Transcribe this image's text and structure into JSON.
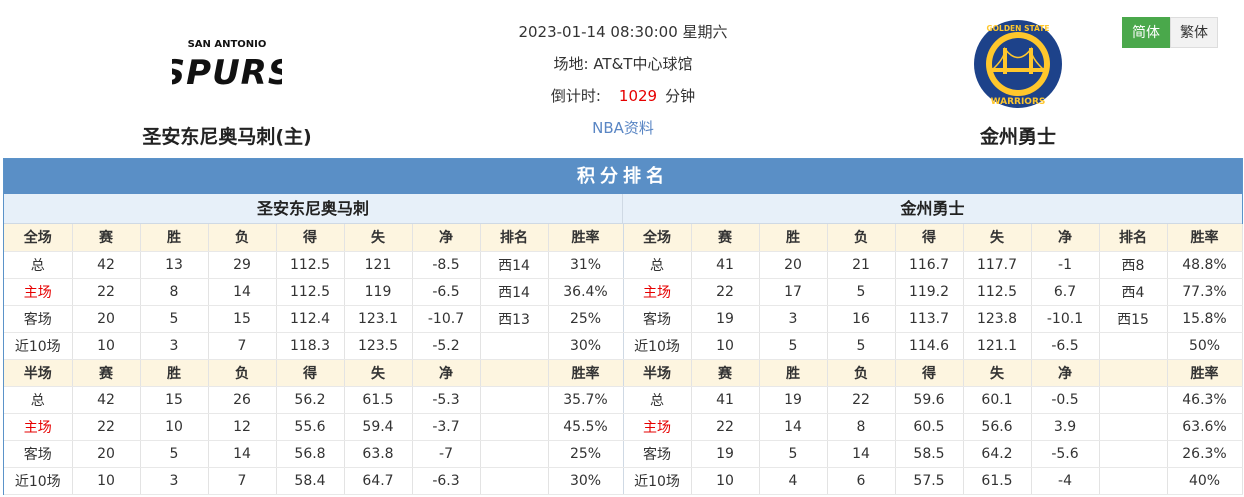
{
  "home_team": {
    "name": "圣安东尼奥马刺(主)",
    "logo": "spurs-logo",
    "logo_text_top": "SAN ANTONIO",
    "logo_text_main": "SPURS"
  },
  "away_team": {
    "name": "金州勇士",
    "logo": "warriors-logo",
    "logo_text_top": "GOLDEN STATE",
    "logo_text_bottom": "WARRIORS"
  },
  "match": {
    "datetime": "2023-01-14 08:30:00 星期六",
    "venue": "场地: AT&T中心球馆",
    "countdown_label": "倒计时:",
    "countdown_value": "1029",
    "countdown_unit": "分钟",
    "nba_link": "NBA资料"
  },
  "lang": {
    "simplified": "简体",
    "traditional": "繁体"
  },
  "standings": {
    "title": "积分排名",
    "home_title": "圣安东尼奥马刺",
    "away_title": "金州勇士",
    "full_header": [
      "全场",
      "赛",
      "胜",
      "负",
      "得",
      "失",
      "净",
      "排名",
      "胜率"
    ],
    "half_header": [
      "半场",
      "赛",
      "胜",
      "负",
      "得",
      "失",
      "净",
      "",
      "胜率"
    ],
    "full_rows": [
      {
        "home": [
          "总",
          "42",
          "13",
          "29",
          "112.5",
          "121",
          "-8.5",
          "西14",
          "31%"
        ],
        "away": [
          "总",
          "41",
          "20",
          "21",
          "116.7",
          "117.7",
          "-1",
          "西8",
          "48.8%"
        ]
      },
      {
        "home": [
          "主场",
          "22",
          "8",
          "14",
          "112.5",
          "119",
          "-6.5",
          "西14",
          "36.4%"
        ],
        "away": [
          "主场",
          "22",
          "17",
          "5",
          "119.2",
          "112.5",
          "6.7",
          "西4",
          "77.3%"
        ]
      },
      {
        "home": [
          "客场",
          "20",
          "5",
          "15",
          "112.4",
          "123.1",
          "-10.7",
          "西13",
          "25%"
        ],
        "away": [
          "客场",
          "19",
          "3",
          "16",
          "113.7",
          "123.8",
          "-10.1",
          "西15",
          "15.8%"
        ]
      },
      {
        "home": [
          "近10场",
          "10",
          "3",
          "7",
          "118.3",
          "123.5",
          "-5.2",
          "",
          "30%"
        ],
        "away": [
          "近10场",
          "10",
          "5",
          "5",
          "114.6",
          "121.1",
          "-6.5",
          "",
          "50%"
        ]
      }
    ],
    "half_rows": [
      {
        "home": [
          "总",
          "42",
          "15",
          "26",
          "56.2",
          "61.5",
          "-5.3",
          "",
          "35.7%"
        ],
        "away": [
          "总",
          "41",
          "19",
          "22",
          "59.6",
          "60.1",
          "-0.5",
          "",
          "46.3%"
        ]
      },
      {
        "home": [
          "主场",
          "22",
          "10",
          "12",
          "55.6",
          "59.4",
          "-3.7",
          "",
          "45.5%"
        ],
        "away": [
          "主场",
          "22",
          "14",
          "8",
          "60.5",
          "56.6",
          "3.9",
          "",
          "63.6%"
        ]
      },
      {
        "home": [
          "客场",
          "20",
          "5",
          "14",
          "56.8",
          "63.8",
          "-7",
          "",
          "25%"
        ],
        "away": [
          "客场",
          "19",
          "5",
          "14",
          "58.5",
          "64.2",
          "-5.6",
          "",
          "26.3%"
        ]
      },
      {
        "home": [
          "近10场",
          "10",
          "3",
          "7",
          "58.4",
          "64.7",
          "-6.3",
          "",
          "30%"
        ],
        "away": [
          "近10场",
          "10",
          "4",
          "6",
          "57.5",
          "61.5",
          "-4",
          "",
          "40%"
        ]
      }
    ]
  },
  "colors": {
    "title_bar": "#5a8fc6",
    "header_row": "#fdf5e0",
    "home_label": "#e60000",
    "countdown": "#e60000",
    "active_lang": "#4aa84b"
  }
}
